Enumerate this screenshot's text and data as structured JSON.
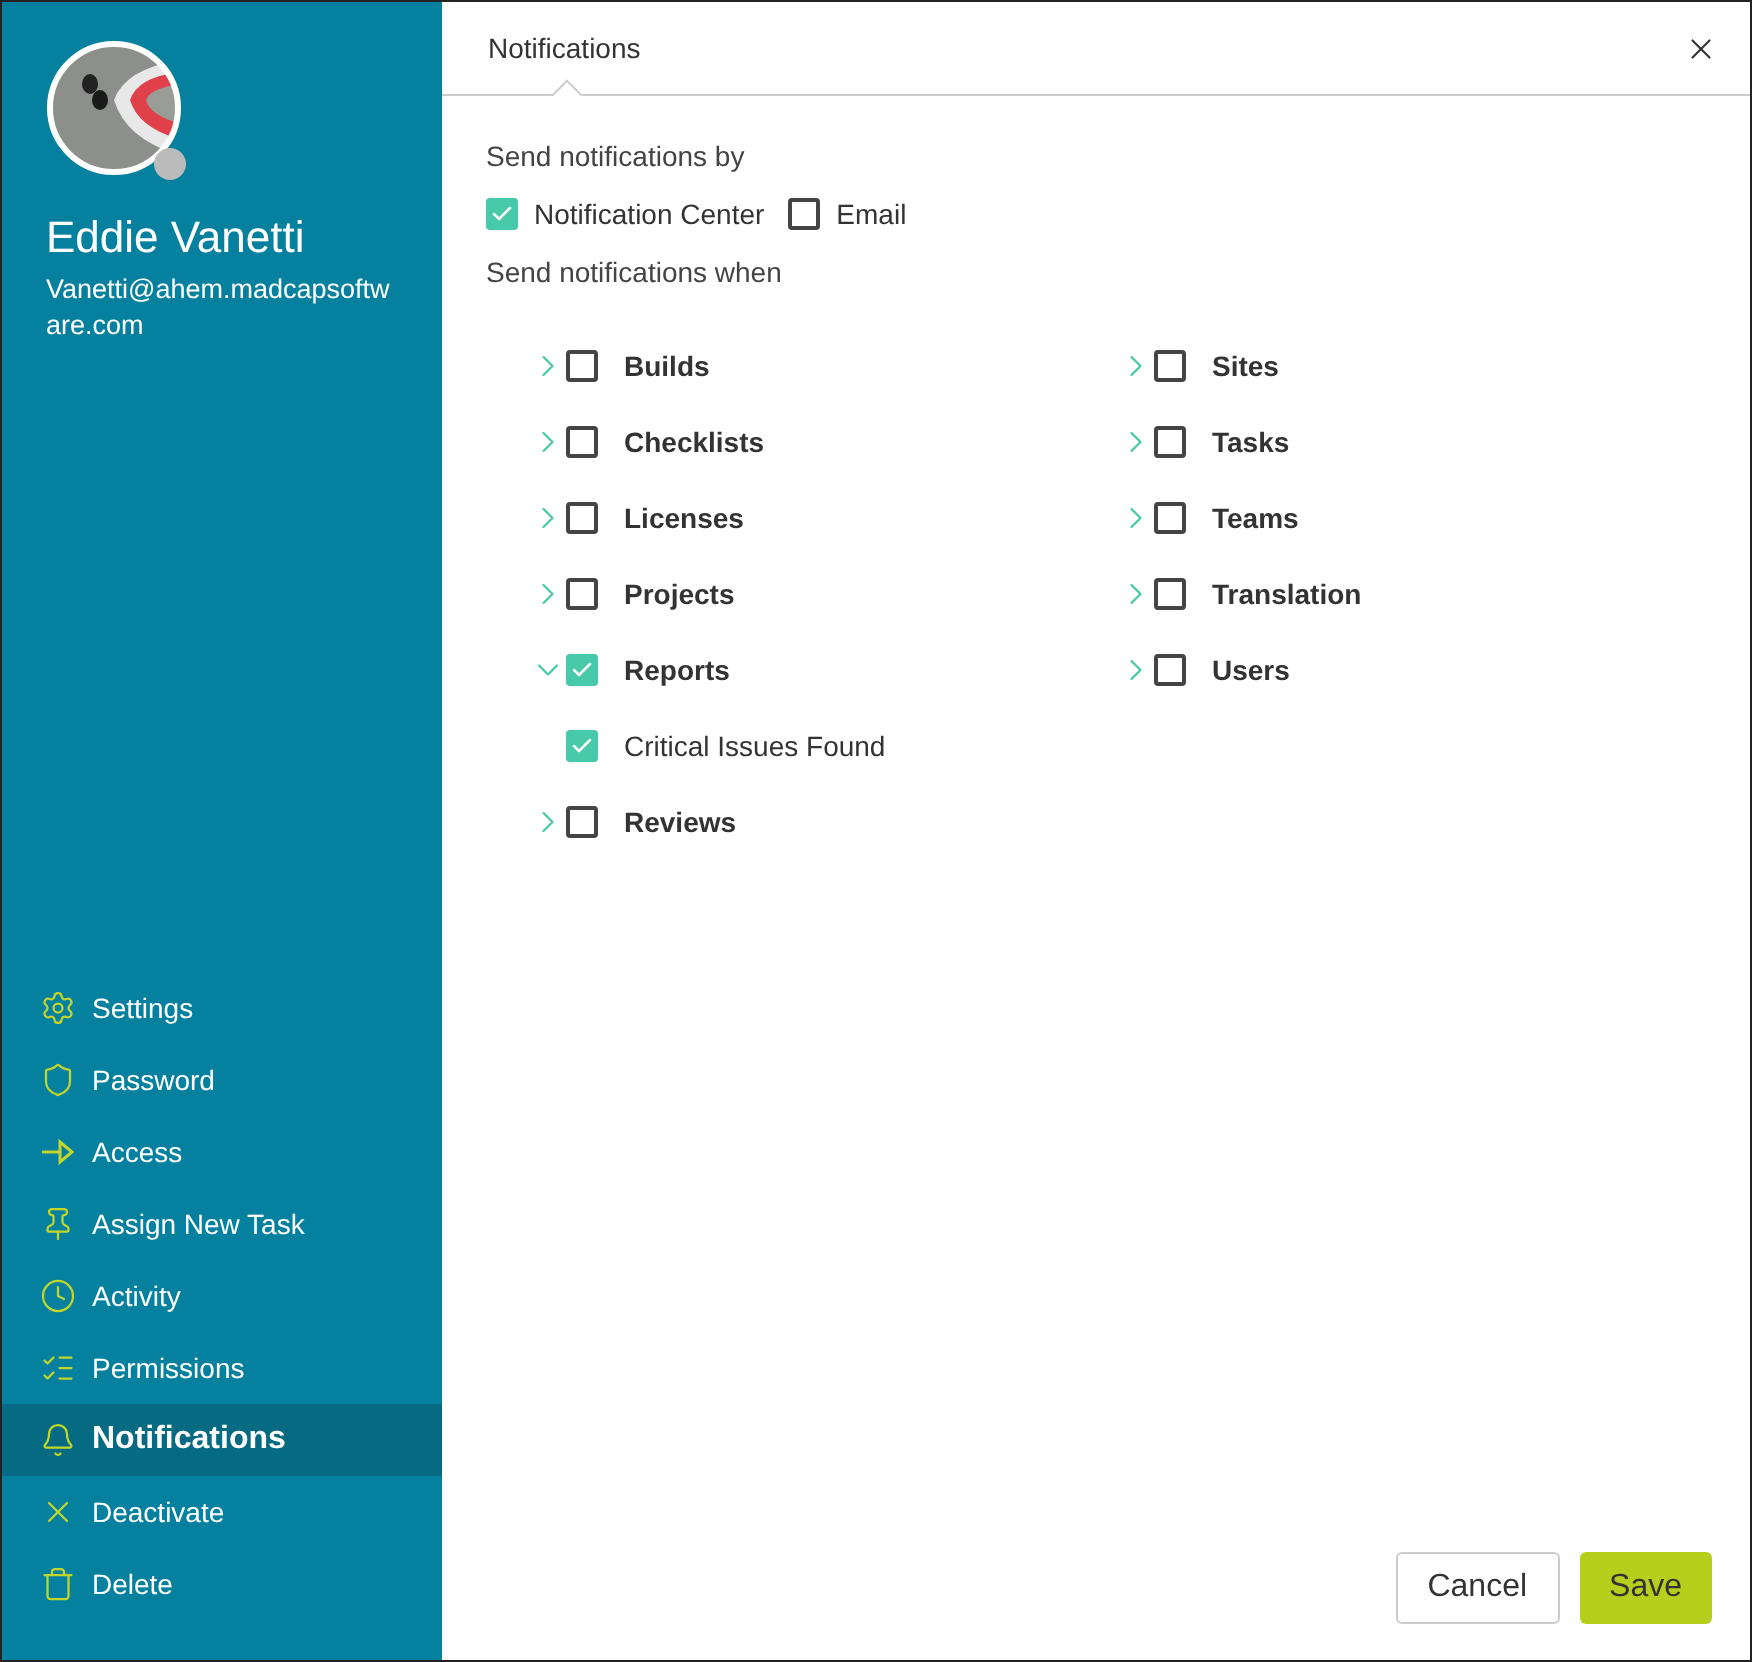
{
  "profile": {
    "name": "Eddie Vanetti",
    "email": "Vanetti@ahem.madcapsoftware.com"
  },
  "menu": [
    {
      "label": "Settings",
      "kind": "gear",
      "selected": false
    },
    {
      "label": "Password",
      "kind": "shield",
      "selected": false
    },
    {
      "label": "Access",
      "kind": "access",
      "selected": false
    },
    {
      "label": "Assign New Task",
      "kind": "pin",
      "selected": false
    },
    {
      "label": "Activity",
      "kind": "clock",
      "selected": false
    },
    {
      "label": "Permissions",
      "kind": "list",
      "selected": false
    },
    {
      "label": "Notifications",
      "kind": "bell",
      "selected": true
    },
    {
      "label": "Deactivate",
      "kind": "x",
      "selected": false
    },
    {
      "label": "Delete",
      "kind": "trash",
      "selected": false
    }
  ],
  "tab": {
    "label": "Notifications"
  },
  "send_by": {
    "label": "Send notifications by",
    "options": [
      {
        "label": "Notification Center",
        "checked": true
      },
      {
        "label": "Email",
        "checked": false
      }
    ]
  },
  "send_when": {
    "label": "Send notifications when",
    "columns": [
      [
        {
          "label": "Builds",
          "checked": false,
          "expanded": false
        },
        {
          "label": "Checklists",
          "checked": false,
          "expanded": false
        },
        {
          "label": "Licenses",
          "checked": false,
          "expanded": false
        },
        {
          "label": "Projects",
          "checked": false,
          "expanded": false
        },
        {
          "label": "Reports",
          "checked": true,
          "expanded": true,
          "children": [
            {
              "label": "Critical Issues Found",
              "checked": true
            }
          ]
        },
        {
          "label": "Reviews",
          "checked": false,
          "expanded": false
        }
      ],
      [
        {
          "label": "Sites",
          "checked": false,
          "expanded": false
        },
        {
          "label": "Tasks",
          "checked": false,
          "expanded": false
        },
        {
          "label": "Teams",
          "checked": false,
          "expanded": false
        },
        {
          "label": "Translation",
          "checked": false,
          "expanded": false
        },
        {
          "label": "Users",
          "checked": false,
          "expanded": false
        }
      ]
    ]
  },
  "buttons": [
    {
      "label": "Cancel",
      "kind": "secondary"
    },
    {
      "label": "Save",
      "kind": "primary"
    }
  ]
}
